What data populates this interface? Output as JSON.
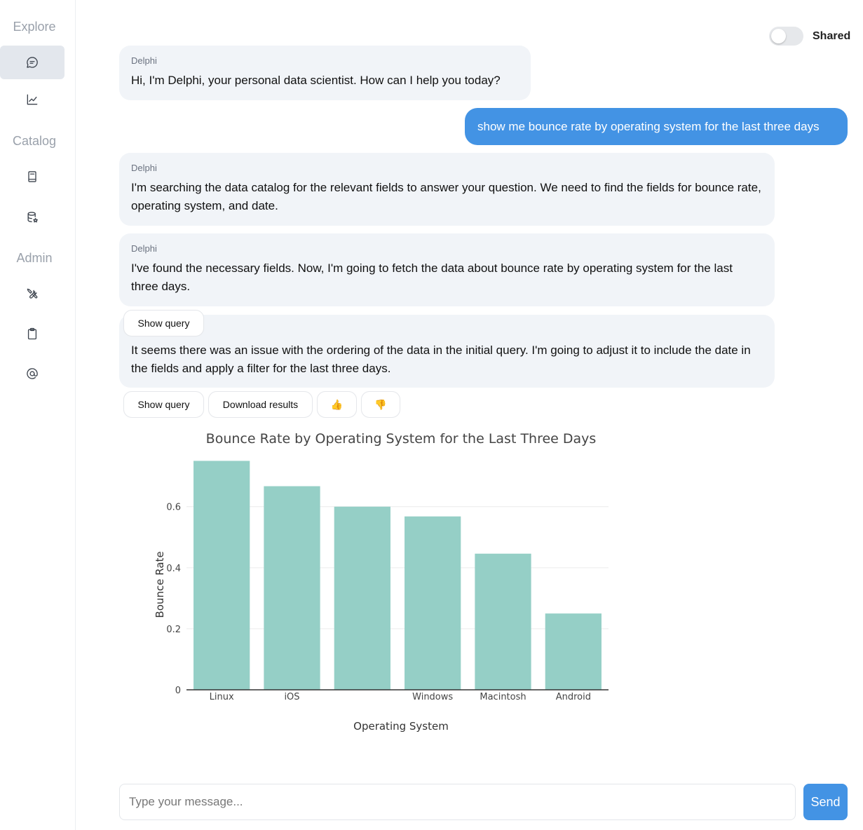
{
  "sidebar": {
    "sections": [
      "Explore",
      "Catalog",
      "Admin"
    ]
  },
  "header": {
    "shared_label": "Shared",
    "shared_on": false
  },
  "messages": {
    "m1": {
      "sender": "Delphi",
      "text": "Hi, I'm Delphi, your personal data scientist. How can I help you today?"
    },
    "user": {
      "text": "show me bounce rate by operating system for the last three days"
    },
    "m2": {
      "sender": "Delphi",
      "text": "I'm searching the data catalog for the relevant fields to answer your question. We need to find the fields for bounce rate, operating system, and date."
    },
    "m3": {
      "sender": "Delphi",
      "text": "I've found the necessary fields. Now, I'm going to fetch the data about bounce rate by operating system for the last three days."
    },
    "m4": {
      "text": "It seems there was an issue with the ordering of the data in the initial query. I'm going to adjust it to include the date in the fields and apply a filter for the last three days."
    }
  },
  "actions": {
    "show_query": "Show query",
    "download_results": "Download results",
    "thumbs_up": "👍",
    "thumbs_down": "👎"
  },
  "chart_data": {
    "type": "bar",
    "title": "Bounce Rate by Operating System for the Last Three Days",
    "xlabel": "Operating System",
    "ylabel": "Bounce Rate",
    "categories": [
      "Linux",
      "iOS",
      "",
      "Windows",
      "Macintosh",
      "Android"
    ],
    "values": [
      0.75,
      0.667,
      0.6,
      0.568,
      0.446,
      0.25
    ],
    "yticks": [
      0,
      0.2,
      0.4,
      0.6
    ],
    "ytick_labels": [
      "0",
      "0.2",
      "0.4",
      "0.6"
    ],
    "ylim": [
      0,
      0.79
    ],
    "color": "#95cfc6",
    "grid": true
  },
  "composer": {
    "placeholder": "Type your message...",
    "send_label": "Send"
  }
}
